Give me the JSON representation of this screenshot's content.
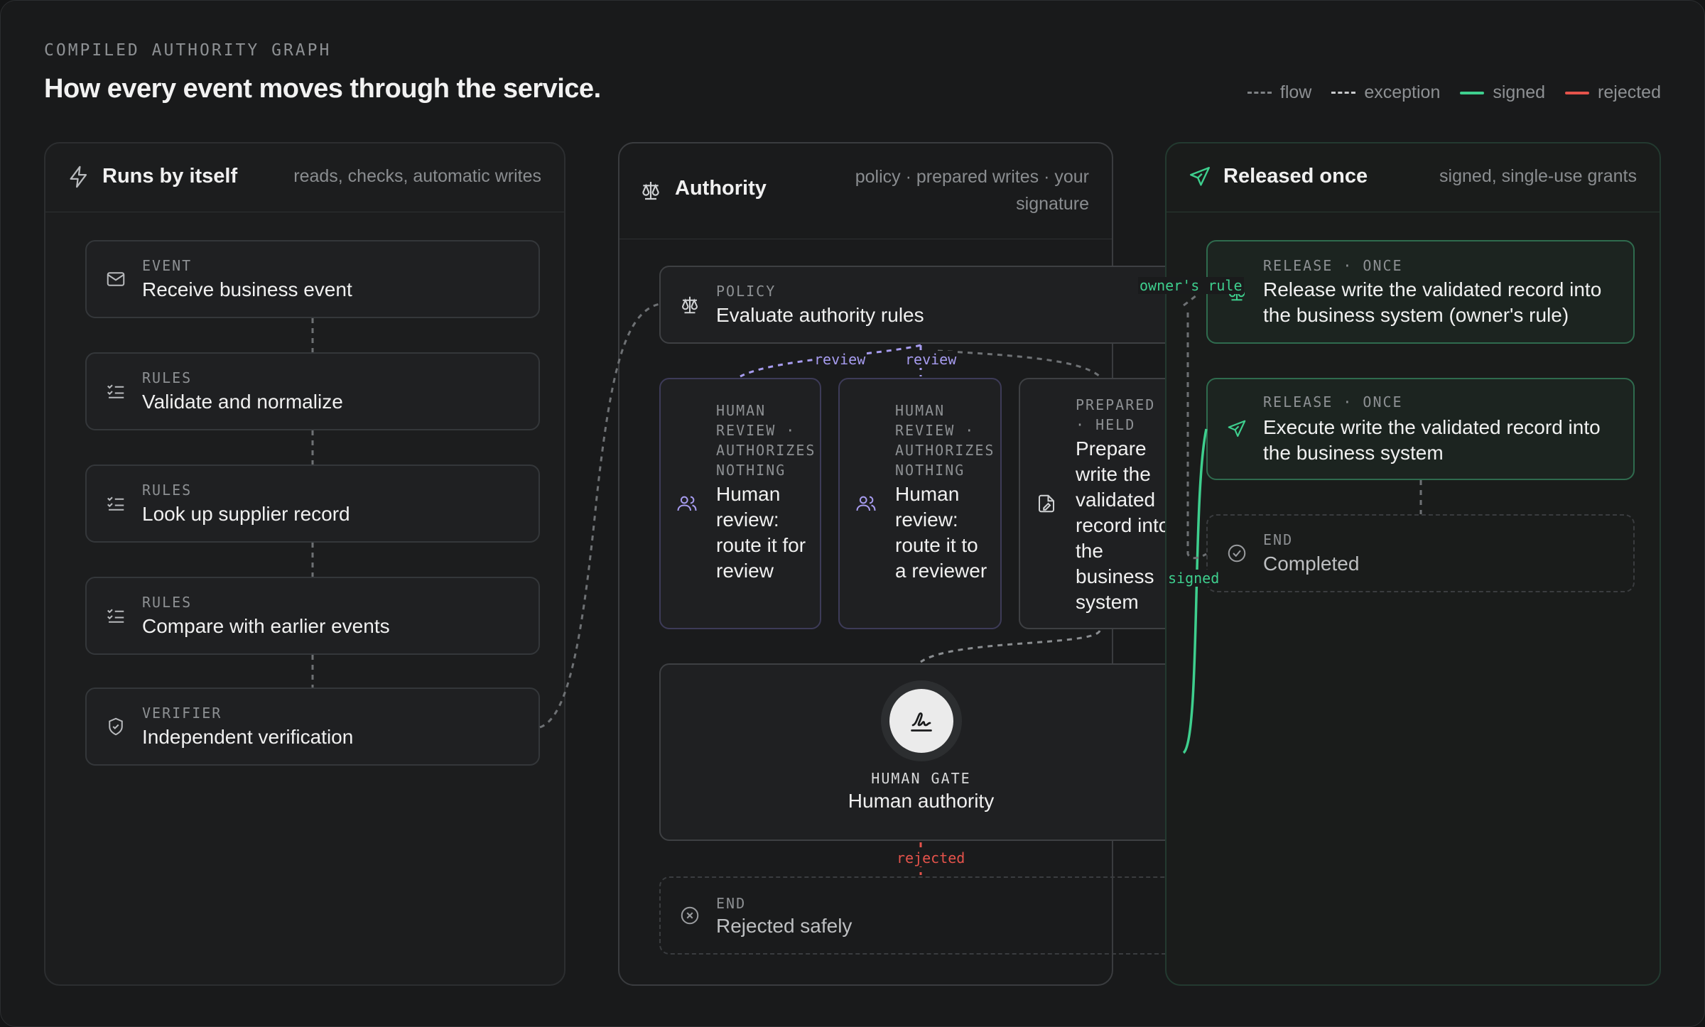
{
  "header": {
    "eyebrow": "COMPILED AUTHORITY GRAPH",
    "title": "How every event moves through the service."
  },
  "legend": [
    {
      "label": "flow",
      "style": "dashed",
      "color": "#7e8184"
    },
    {
      "label": "exception",
      "style": "dashed",
      "color": "#c8cacc"
    },
    {
      "label": "signed",
      "style": "solid",
      "color": "#3ecf8e"
    },
    {
      "label": "rejected",
      "style": "solid",
      "color": "#e5534b"
    }
  ],
  "columns": {
    "runs": {
      "name": "Runs by itself",
      "subtitle": "reads, checks, automatic writes",
      "icon": "lightning-icon",
      "nodes": [
        {
          "tag": "EVENT",
          "label": "Receive business event",
          "icon": "mail-icon"
        },
        {
          "tag": "RULES",
          "label": "Validate and normalize",
          "icon": "checklist-icon"
        },
        {
          "tag": "RULES",
          "label": "Look up supplier record",
          "icon": "checklist-icon"
        },
        {
          "tag": "RULES",
          "label": "Compare with earlier events",
          "icon": "checklist-icon"
        },
        {
          "tag": "VERIFIER",
          "label": "Independent verification",
          "icon": "shield-check-icon"
        }
      ]
    },
    "authority": {
      "name": "Authority",
      "subtitle": "policy · prepared writes · your signature",
      "icon": "scales-icon",
      "policy": {
        "tag": "POLICY",
        "label": "Evaluate authority rules",
        "icon": "scales-icon"
      },
      "review1": {
        "tag": "HUMAN REVIEW · AUTHORIZES NOTHING",
        "label": "Human review: route it for review",
        "icon": "users-icon"
      },
      "review2": {
        "tag": "HUMAN REVIEW · AUTHORIZES NOTHING",
        "label": "Human review: route it to a reviewer",
        "icon": "users-icon"
      },
      "prepared": {
        "tag": "PREPARED · HELD",
        "label": "Prepare write the validated record into the business system",
        "icon": "document-pen-icon"
      },
      "gate": {
        "tag": "HUMAN GATE",
        "label": "Human authority",
        "icon": "signature-icon"
      },
      "end": {
        "tag": "END",
        "label": "Rejected safely",
        "icon": "x-circle-icon"
      }
    },
    "released": {
      "name": "Released once",
      "subtitle": "signed, single-use grants",
      "icon": "send-icon",
      "release1": {
        "tag": "RELEASE · ONCE",
        "label": "Release write the validated record into the business system (owner's rule)",
        "icon": "scales-icon"
      },
      "release2": {
        "tag": "RELEASE · ONCE",
        "label": "Execute write the validated record into the business system",
        "icon": "send-icon"
      },
      "end": {
        "tag": "END",
        "label": "Completed",
        "icon": "check-circle-icon"
      }
    }
  },
  "edge_labels": {
    "review_a": "review",
    "review_b": "review",
    "owners_rule": "owner's rule",
    "signed": "signed",
    "rejected": "rejected"
  },
  "colors": {
    "signed": "#3ecf8e",
    "rejected": "#e5534b",
    "review": "#a79cf0"
  }
}
